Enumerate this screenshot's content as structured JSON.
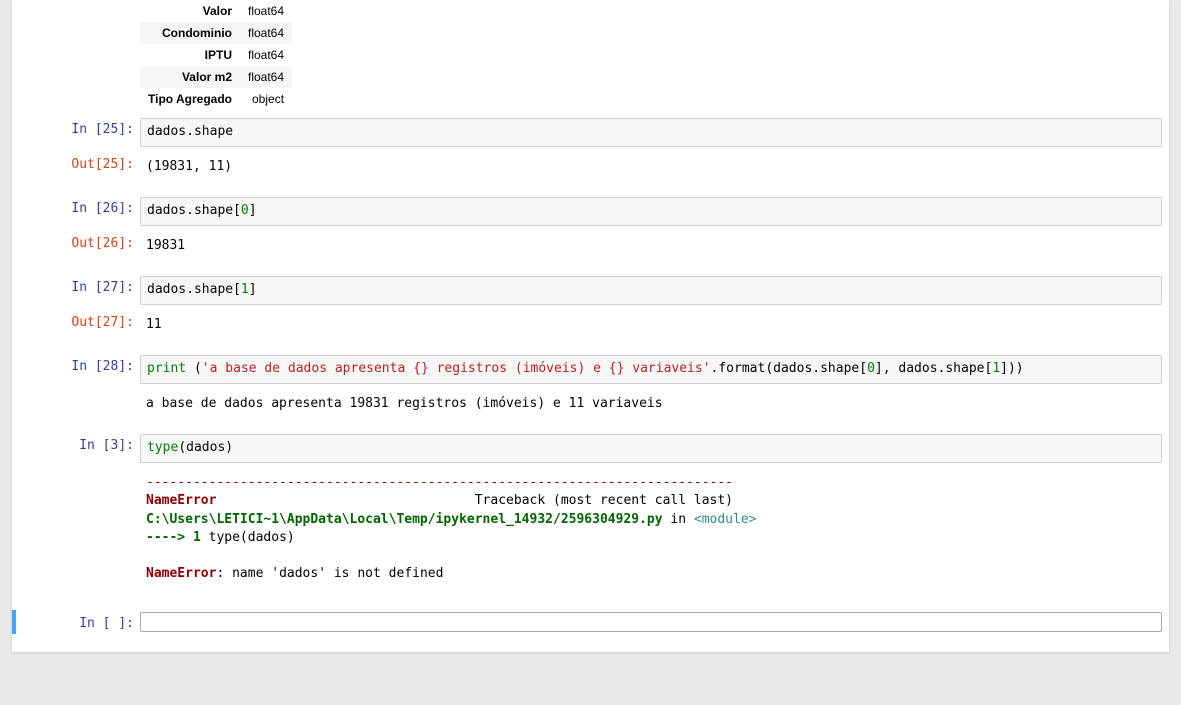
{
  "dtype_table": {
    "rows": [
      {
        "name": "Valor",
        "dtype": "float64"
      },
      {
        "name": "Condominio",
        "dtype": "float64"
      },
      {
        "name": "IPTU",
        "dtype": "float64"
      },
      {
        "name": "Valor m2",
        "dtype": "float64"
      },
      {
        "name": "Tipo Agregado",
        "dtype": "object"
      }
    ]
  },
  "cells": {
    "c25": {
      "in_label": "In [25]:",
      "code": "dados.shape",
      "out_label": "Out[25]:",
      "output": "(19831, 11)"
    },
    "c26": {
      "in_label": "In [26]:",
      "code_pre": "dados.shape[",
      "code_idx": "0",
      "code_post": "]",
      "out_label": "Out[26]:",
      "output": "19831"
    },
    "c27": {
      "in_label": "In [27]:",
      "code_pre": "dados.shape[",
      "code_idx": "1",
      "code_post": "]",
      "out_label": "Out[27]:",
      "output": "11"
    },
    "c28": {
      "in_label": "In [28]:",
      "builtin": "print",
      "space": " (",
      "string": "'a base de dados apresenta {} registros (imóveis) e {} variaveis'",
      "tail_a": ".format(dados.shape[",
      "idx0": "0",
      "tail_b": "], dados.shape[",
      "idx1": "1",
      "tail_c": "]))",
      "output": "a base de dados apresenta 19831 registros (imóveis) e 11 variaveis"
    },
    "c3": {
      "in_label": "In [3]:",
      "builtin": "type",
      "tail": "(dados)",
      "err_dash": "---------------------------------------------------------------------------",
      "err_name1": "NameError",
      "err_trace": "                                 Traceback (most recent call last)",
      "err_path": "C:\\Users\\LETICI~1\\AppData\\Local\\Temp/ipykernel_14932/2596304929.py",
      "err_in": " in ",
      "err_mod": "<module>",
      "err_arrow": "----> 1",
      "err_code": " type(dados)",
      "err_name2": "NameError",
      "err_msg": ": name 'dados' is not defined"
    },
    "empty": {
      "in_label": "In [ ]:",
      "code": ""
    }
  }
}
